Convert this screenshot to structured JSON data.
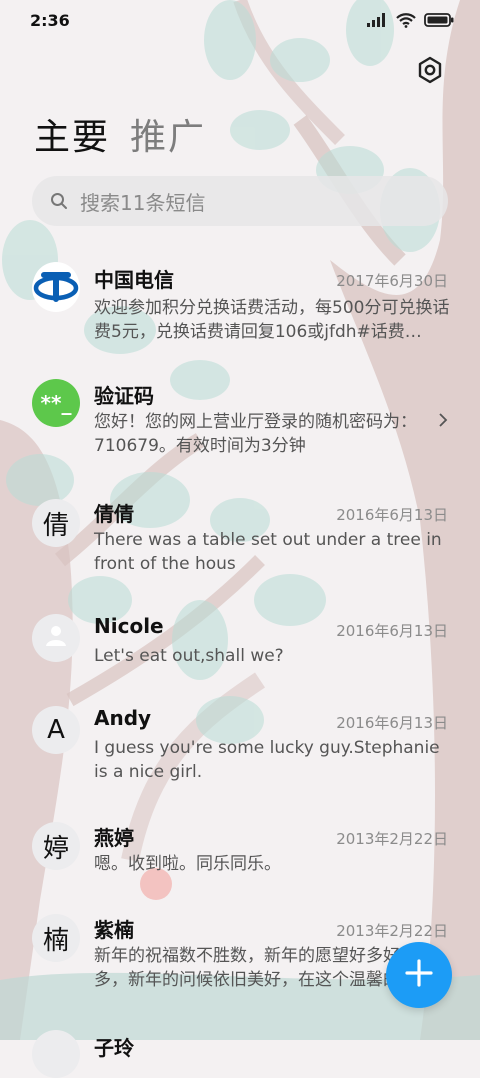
{
  "status_bar": {
    "time": "2:36"
  },
  "tabs": {
    "primary": "主要",
    "secondary": "推广"
  },
  "search": {
    "placeholder": "搜索11条短信"
  },
  "conversations": [
    {
      "name": "中国电信",
      "date": "2017年6月30日",
      "message": "欢迎参加积分兑换话费活动，每500分可兑换话费5元，兑换话费请回复106或jfdh#话费…",
      "avatar": "china-telecom-logo"
    },
    {
      "name": "验证码",
      "date": "",
      "message": "您好！您的网上营业厅登录的随机密码为：710679。有效时间为3分钟",
      "avatar_text": "**_"
    },
    {
      "name": "倩倩",
      "date": "2016年6月13日",
      "message": "There was a table set out under a tree in front of the hous",
      "avatar_text": "倩"
    },
    {
      "name": "Nicole",
      "date": "2016年6月13日",
      "message": "Let's eat out,shall we?",
      "avatar": "person-icon"
    },
    {
      "name": "Andy",
      "date": "2016年6月13日",
      "message": "I guess you're some lucky guy.Stephanie is a nice girl.",
      "avatar_text": "A"
    },
    {
      "name": "燕婷",
      "date": "2013年2月22日",
      "message": "嗯。收到啦。同乐同乐。",
      "avatar_text": "婷"
    },
    {
      "name": "紫楠",
      "date": "2013年2月22日",
      "message": "新年的祝福数不胜数，新年的愿望好多好多，新年的问候依旧美好，在这个温馨的时刻",
      "avatar_text": "楠"
    },
    {
      "name": "子玲",
      "date": "",
      "message": "",
      "avatar_text": ""
    }
  ],
  "colors": {
    "accent": "#1c9cf6",
    "verify_green": "#5dc84b",
    "telecom_blue": "#0a5fb4"
  }
}
